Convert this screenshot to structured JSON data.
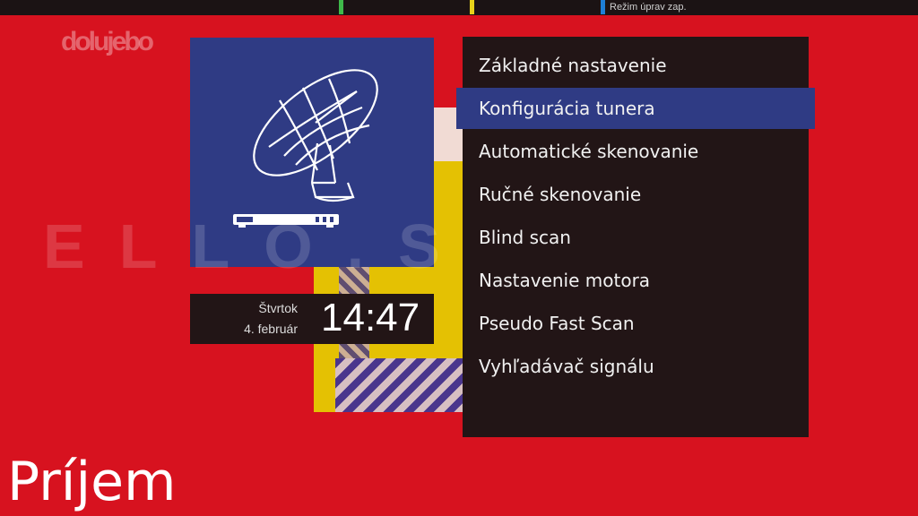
{
  "top_bar": {
    "edit_mode_label": "Režim úprav zap.",
    "color_keys": [
      "#3fb94a",
      "#e8d21a",
      "#1e7fd6"
    ]
  },
  "logo": {
    "text": "dolujebo",
    "icon": "channel-logo"
  },
  "watermark": {
    "text": "ELLO.SK"
  },
  "tile": {
    "icon": "satellite-dish-receiver-icon"
  },
  "clock": {
    "day": "Štvrtok",
    "date": "4. február",
    "time": "14:47"
  },
  "menu": {
    "items": [
      {
        "label": "Základné nastavenie"
      },
      {
        "label": "Konfigurácia tunera"
      },
      {
        "label": "Automatické skenovanie"
      },
      {
        "label": "Ručné skenovanie"
      },
      {
        "label": "Blind scan"
      },
      {
        "label": "Nastavenie motora"
      },
      {
        "label": "Pseudo Fast Scan"
      },
      {
        "label": "Vyhľadávač signálu"
      }
    ],
    "selected_index": 1
  },
  "page": {
    "title": "Príjem"
  },
  "colors": {
    "background": "#d7121f",
    "panel": "#221516",
    "accent": "#2f3b84"
  }
}
